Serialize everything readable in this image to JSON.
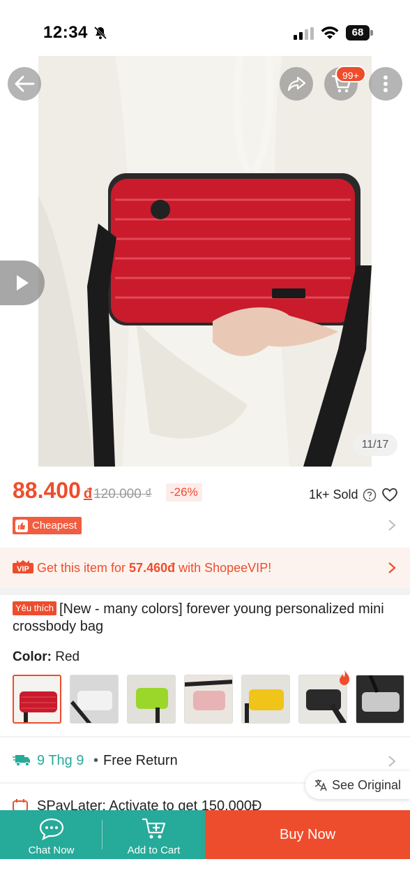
{
  "status_bar": {
    "time": "12:34",
    "battery": "68"
  },
  "header": {
    "cart_badge": "99+"
  },
  "gallery": {
    "counter": "11/17"
  },
  "price": {
    "current": "88.400",
    "currency_symbol": "đ",
    "original": "120.000 ₫",
    "discount": "-26%",
    "sold": "1k+ Sold"
  },
  "badges": {
    "cheapest": "Cheapest"
  },
  "vip": {
    "prefix": "Get this item for ",
    "price": "57.460đ",
    "suffix": " with ShopeeVIP!"
  },
  "product": {
    "fav_label": "Yêu thích",
    "title": "[New - many colors] forever young personalized mini crossbody bag",
    "color_label": "Color:",
    "color_value": "Red"
  },
  "variants": [
    {
      "name": "red",
      "color": "#c91b2b"
    },
    {
      "name": "white",
      "color": "#e6e6e6"
    },
    {
      "name": "green",
      "color": "#9bd72a"
    },
    {
      "name": "pink",
      "color": "#e8b3b5"
    },
    {
      "name": "yellow",
      "color": "#f0c419"
    },
    {
      "name": "black",
      "color": "#2a2a2a"
    },
    {
      "name": "silver",
      "color": "#c9c9c9"
    }
  ],
  "shipping": {
    "date": "9 Thg 9",
    "separator": "•",
    "return": "Free Return"
  },
  "translate": {
    "label": "See Original"
  },
  "spaylater": {
    "text": "SPayLater: Activate to get 150.000Đ"
  },
  "bottom_bar": {
    "chat": "Chat Now",
    "cart": "Add to Cart",
    "buy": "Buy Now"
  },
  "colors": {
    "brand": "#ee4d2d",
    "teal": "#26aa99"
  }
}
